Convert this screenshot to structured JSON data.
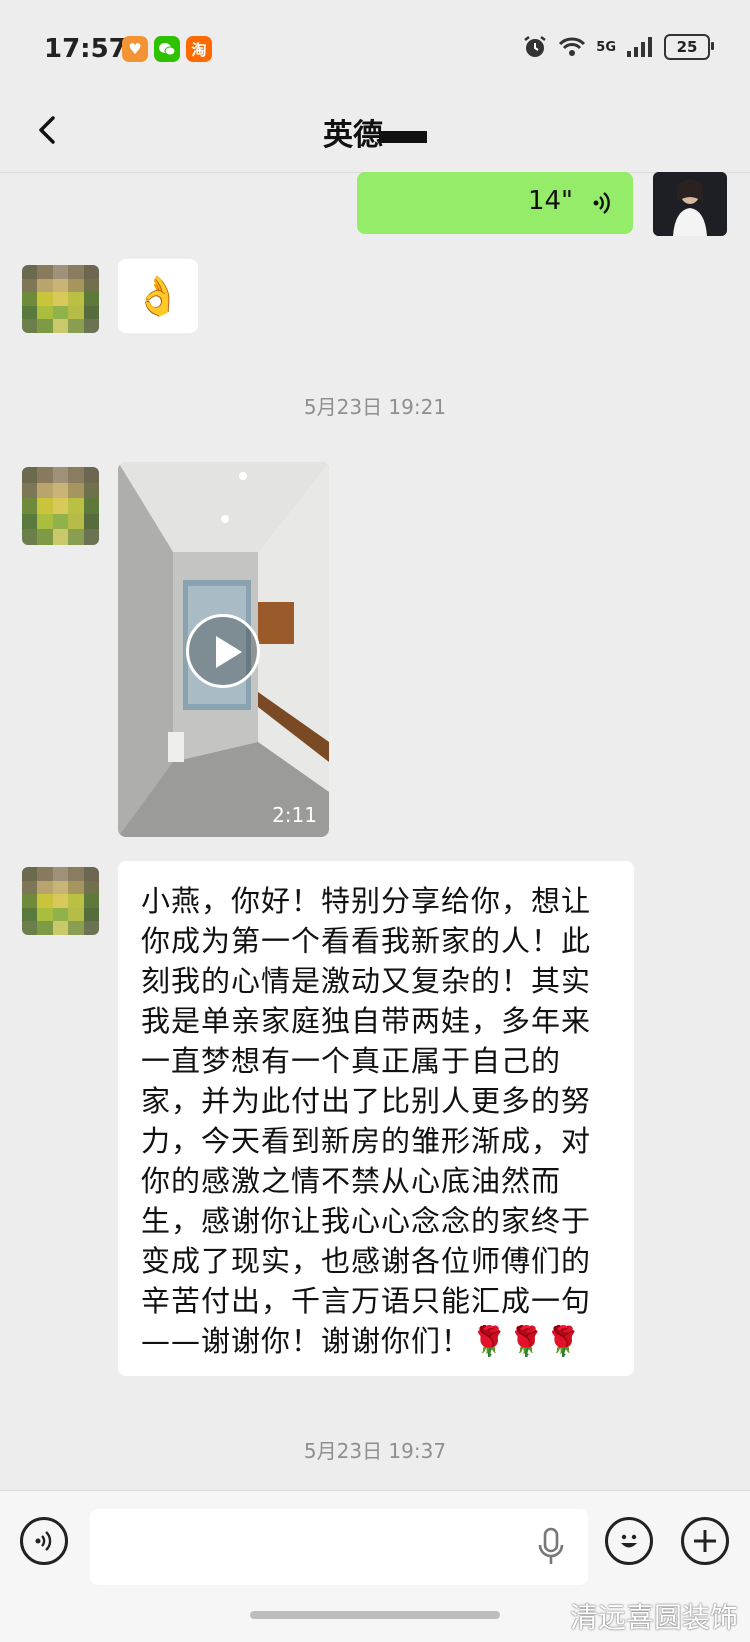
{
  "status_bar": {
    "time": "17:57",
    "app_icons": [
      {
        "icon": "heart-app-icon",
        "glyph": "♥",
        "color": "#f29436"
      },
      {
        "icon": "wechat-app-icon",
        "glyph": "●",
        "color": "#2dc100"
      },
      {
        "icon": "taobao-app-icon",
        "glyph": "淘",
        "color": "#ff6a00"
      }
    ],
    "network": "5G",
    "battery": "25"
  },
  "header": {
    "title": "英德"
  },
  "messages": {
    "voice": {
      "duration": "14\""
    },
    "emoji": "👌",
    "timestamp_1": "5月23日 19:21",
    "video": {
      "duration": "2:11"
    },
    "text": "小燕，你好！特别分享给你，想让你成为第一个看看我新家的人！此刻我的心情是激动又复杂的！其实我是单亲家庭独自带两娃，多年来一直梦想有一个真正属于自己的家，并为此付出了比别人更多的努力，今天看到新房的雏形渐成，对你的感激之情不禁从心底油然而生，感谢你让我心心念念的家终于变成了现实，也感谢各位师傅们的辛苦付出，千言万语只能汇成一句——谢谢你！谢谢你们！🌹🌹🌹",
    "timestamp_2": "5月23日 19:37"
  },
  "input_bar": {
    "placeholder": ""
  },
  "watermark": "清远喜圆装饰",
  "colors": {
    "background": "#ededed",
    "sent_bubble": "#95ec69",
    "received_bubble": "#ffffff",
    "timestamp": "#8f8f8f"
  }
}
